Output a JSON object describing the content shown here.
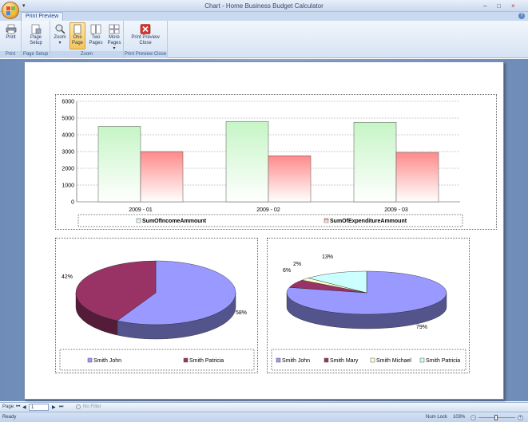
{
  "window": {
    "title": "Chart - Home Business Budget Calculator",
    "qat_glyph": "▾",
    "min": "–",
    "max": "□",
    "close": "×"
  },
  "ribbon": {
    "tab": "Print Preview",
    "help": "?",
    "groups": {
      "print": "Print",
      "page_setup": "Page Setup",
      "zoom": "Zoom",
      "close": "Print Preview Close"
    },
    "buttons": {
      "print": "Print",
      "page_setup_1": "Page",
      "page_setup_2": "Setup",
      "zoom_1": "Zoom",
      "zoom_2": "▾",
      "one_page_1": "One",
      "one_page_2": "Page",
      "two_pages_1": "Two",
      "two_pages_2": "Pages",
      "more_pages_1": "More",
      "more_pages_2": "Pages ▾",
      "close_1": "Print Preview",
      "close_2": "Close"
    }
  },
  "nav": {
    "page_label": "Page:",
    "first": "⏮",
    "prev": "◀",
    "page_value": "1",
    "next": "▶",
    "last": "⏭",
    "no_filter": "No Filter"
  },
  "status": {
    "ready": "Ready",
    "num_lock": "Num Lock",
    "zoom": "103%"
  },
  "colors": {
    "income": "#c6f5c6",
    "expenditure": "#ff8a8a",
    "john": "#9999ff",
    "patricia_left": "#993366",
    "mary": "#993366",
    "michael": "#ffffcc",
    "patricia_right": "#ccffff"
  },
  "chart_data": [
    {
      "type": "bar",
      "categories": [
        "2009 - 01",
        "2009 - 02",
        "2009 - 03"
      ],
      "series": [
        {
          "name": "SumOfIncomeAmmount",
          "values": [
            4500,
            4800,
            4750
          ]
        },
        {
          "name": "SumOfExpenditureAmmount",
          "values": [
            3000,
            2750,
            2950
          ]
        }
      ],
      "yticks": [
        "6000",
        "5000",
        "4000",
        "3000",
        "2000",
        "1000",
        "0"
      ],
      "ylim": [
        0,
        6000
      ],
      "grid": true,
      "legend": "bottom"
    },
    {
      "type": "pie",
      "labels": [
        "Smith John",
        "Smith Patricia"
      ],
      "values": [
        58,
        42
      ],
      "value_labels": [
        "58%",
        "42%"
      ],
      "legend": "bottom"
    },
    {
      "type": "pie",
      "labels": [
        "Smith John",
        "Smith Mary",
        "Smith Michael",
        "Smith Patricia"
      ],
      "values": [
        79,
        6,
        2,
        13
      ],
      "value_labels": [
        "79%",
        "6%",
        "2%",
        "13%"
      ],
      "legend": "bottom"
    }
  ]
}
